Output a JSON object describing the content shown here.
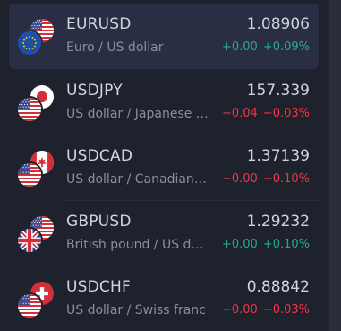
{
  "colors": {
    "up": "#22ab94",
    "down": "#f23645",
    "selected_bg": "#2a2e45"
  },
  "rows": [
    {
      "symbol": "EURUSD",
      "description": "Euro / US dollar",
      "price": "1.08906",
      "change": "+0.00",
      "change_pct": "+0.09%",
      "direction": "up",
      "selected": true,
      "flags": [
        "us-flag-icon",
        "eu-flag-icon"
      ]
    },
    {
      "symbol": "USDJPY",
      "description": "US dollar / Japanese yen",
      "price": "157.339",
      "change": "−0.04",
      "change_pct": "−0.03%",
      "direction": "down",
      "selected": false,
      "flags": [
        "jp-flag-icon",
        "us-flag-icon"
      ]
    },
    {
      "symbol": "USDCAD",
      "description": "US dollar / Canadian dollar",
      "price": "1.37139",
      "change": "−0.00",
      "change_pct": "−0.10%",
      "direction": "down",
      "selected": false,
      "flags": [
        "ca-flag-icon",
        "us-flag-icon"
      ]
    },
    {
      "symbol": "GBPUSD",
      "description": "British pound / US dollar",
      "price": "1.29232",
      "change": "+0.00",
      "change_pct": "+0.10%",
      "direction": "up",
      "selected": false,
      "flags": [
        "us-flag-icon",
        "gb-flag-icon"
      ]
    },
    {
      "symbol": "USDCHF",
      "description": "US dollar / Swiss franc",
      "price": "0.88842",
      "change": "−0.00",
      "change_pct": "−0.03%",
      "direction": "down",
      "selected": false,
      "flags": [
        "ch-flag-icon",
        "us-flag-icon"
      ]
    }
  ]
}
